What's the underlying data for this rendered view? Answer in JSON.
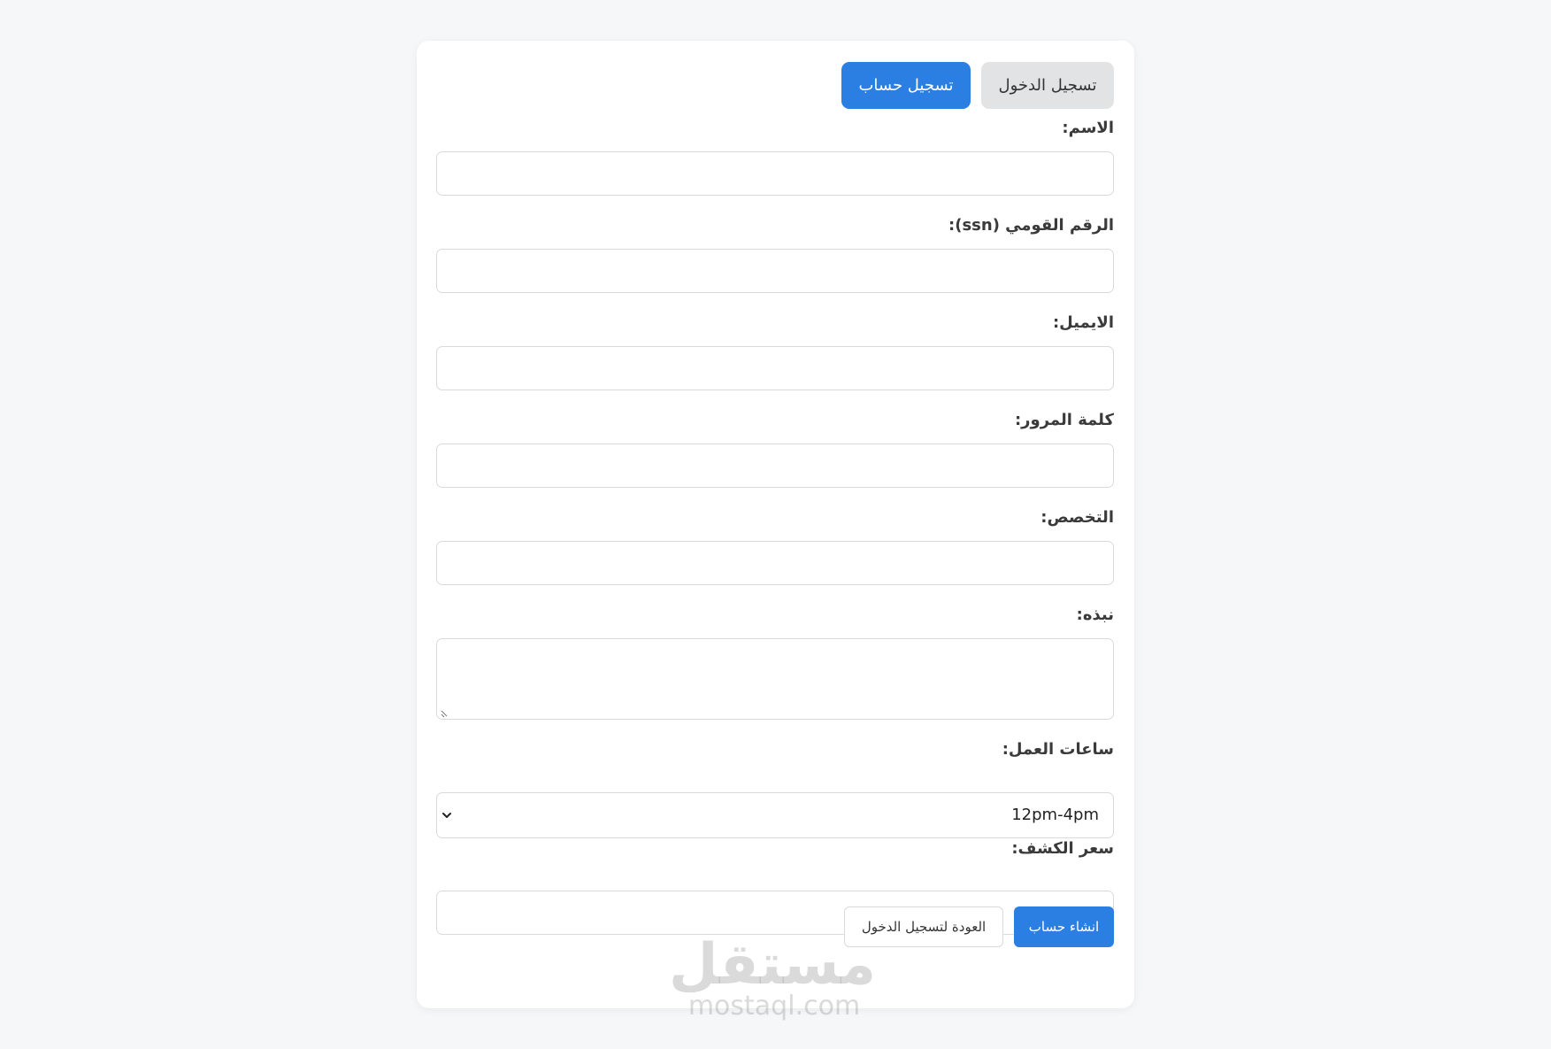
{
  "tabs": {
    "login_label": "تسجيل الدخول",
    "signup_label": "تسجيل حساب",
    "active": "signup"
  },
  "form": {
    "name_label": "الاسم:",
    "ssn_label": "الرقم القومي (ssn):",
    "email_label": "الايميل:",
    "password_label": "كلمة المرور:",
    "specialty_label": "التخصص:",
    "bio_label": "نبذه:",
    "hours_label": "ساعات العمل:",
    "hours_value": "12pm-4pm",
    "price_label": "سعر الكشف:"
  },
  "actions": {
    "create_label": "انشاء حساب",
    "back_label": "العودة لتسجيل الدخول"
  },
  "watermark": {
    "logo": "مستقل",
    "url": "mostaql.com"
  },
  "colors": {
    "accent": "#2b7fe3",
    "tab_inactive": "#e2e3e5",
    "page_bg": "#f6f7f9"
  }
}
